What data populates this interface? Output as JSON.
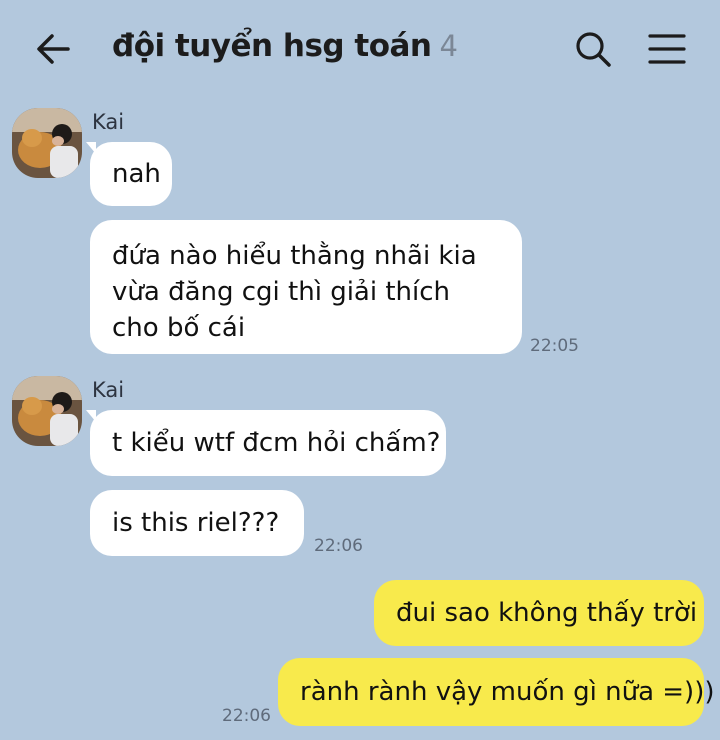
{
  "header": {
    "title": "đội tuyển hsg toán",
    "member_count": "4"
  },
  "messages": [
    {
      "sender": "Kai",
      "text": "nah"
    },
    {
      "text": "đứa nào hiểu thằng nhãi kia vừa đăng cgi thì giải thích cho bố cái",
      "time": "22:05"
    },
    {
      "sender": "Kai",
      "text": "t kiểu wtf đcm hỏi chấm?"
    },
    {
      "text": "is this riel???",
      "time": "22:06"
    },
    {
      "text": "đui sao không thấy trời"
    },
    {
      "text": "rành rành vậy muốn gì nữa =)))",
      "time": "22:06"
    }
  ],
  "colors": {
    "background": "#b3c8dd",
    "incoming_bubble": "#ffffff",
    "outgoing_bubble": "#f8ea4c"
  }
}
